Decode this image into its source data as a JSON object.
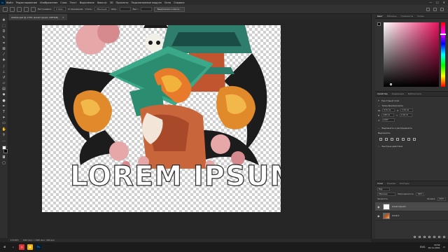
{
  "menubar": {
    "app_icon": "Ps",
    "items": [
      "Файл",
      "Редактирование",
      "Изображение",
      "Слои",
      "Текст",
      "Выделение",
      "Фильтр",
      "3D",
      "Просмотр",
      "Подключаемые модули",
      "Окно",
      "Справка"
    ],
    "window_controls": [
      "—",
      "☐",
      "✕"
    ]
  },
  "options": {
    "feather_label": "Растушевка:",
    "feather_value": "0 пикс.",
    "antialias_label": "Сглаживание",
    "style_label": "Стиль:",
    "style_value": "Обычный",
    "width_label": "Шир.:",
    "height_label": "Выс.:",
    "select_mask_button": "Выделение и маска..."
  },
  "document": {
    "tab_title": "shoban.psd @ 173% (Lorem Ipsum, CMYK/8)",
    "close": "×"
  },
  "canvas": {
    "headline": "LOREM IPSUM"
  },
  "status": {
    "zoom": "173,02%",
    "doc_info": "1914 пикс. x 1500 пикс. (300 ppi)"
  },
  "color_panel": {
    "tabs": [
      "Цвет",
      "Образцы",
      "Градиенты",
      "Узоры"
    ],
    "colors": {
      "hue_pink": "#e8125e"
    }
  },
  "properties_panel": {
    "tabs": [
      "Свойства",
      "Коррекция",
      "Библиотеки"
    ],
    "layer_kind": "Текстовый слой",
    "transform_label": "Трансформировать",
    "w_value": "6,31 см",
    "h_value": "1,89 см",
    "x_value": "1,31 см",
    "y_value": "2,16 см",
    "angle_value": "0,00°",
    "align_label": "Выровнять и распределить",
    "align_sublabel": "Выровнять:",
    "quick_actions_label": "Быстрые действия"
  },
  "layers_panel": {
    "tabs": [
      "Слои",
      "Каналы",
      "Контуры"
    ],
    "filter_value": "Вид",
    "blend_mode": "Обычные",
    "opacity_label": "Непрозрачность:",
    "opacity_value": "100%",
    "lock_label": "Закрепить:",
    "fill_label": "Заливка:",
    "fill_value": "100%",
    "layers": [
      {
        "name": "Lorem Ipsum",
        "selected": true,
        "kind": "text"
      },
      {
        "name": "Слой 1",
        "selected": false,
        "kind": "image"
      }
    ]
  },
  "taskbar": {
    "apps": [
      "⊞",
      "⌕",
      "◎",
      "▣",
      "Ps"
    ],
    "tray_lang": "ENG",
    "time": "15:52",
    "date": "16.11.2021"
  }
}
